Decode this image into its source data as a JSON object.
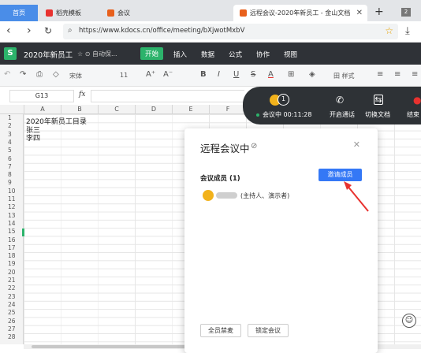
{
  "browser": {
    "tabs": [
      {
        "label": "首页"
      },
      {
        "label": "稻壳模板"
      },
      {
        "label": "会议"
      },
      {
        "label": "远程会议-2020年新员工 - 金山文档"
      }
    ],
    "tab_close": "✕",
    "new_tab": "+",
    "url": "https://www.kdocs.cn/office/meeting/bXjwotMxbV"
  },
  "app": {
    "title": "2020年新员工",
    "status": "☆ ⊙ 自动保...",
    "menus": [
      "开始",
      "插入",
      "数据",
      "公式",
      "协作",
      "视图"
    ]
  },
  "toolbar": {
    "font": "宋体",
    "size": "11",
    "style_label": "田 样式"
  },
  "formula": {
    "cell_ref": "G13",
    "fx": "fx"
  },
  "grid": {
    "columns": [
      "A",
      "B",
      "C",
      "D",
      "E",
      "F"
    ],
    "rows": [
      "1",
      "2",
      "3",
      "4",
      "5",
      "6",
      "7",
      "8",
      "9",
      "10",
      "11",
      "12",
      "13",
      "14",
      "15",
      "16",
      "17",
      "18",
      "19",
      "20",
      "21",
      "22",
      "23",
      "24",
      "25",
      "26",
      "27",
      "28"
    ],
    "cells": {
      "a1": "2020年新员工目录",
      "a2": "张三",
      "a3": "李四"
    }
  },
  "meeting_bar": {
    "member_count": "1",
    "status": "会议中 00:11:28",
    "actions": [
      "开启通话",
      "切换文档",
      "结束"
    ]
  },
  "meeting_panel": {
    "title": "远程会议中",
    "members_label": "会议成员 (1)",
    "invite_button": "邀请成员",
    "member_role": "(主持人、演示者)",
    "mute_all": "全员禁麦",
    "lock": "锁定会议"
  },
  "colors": {
    "accent_green": "#2cb36b",
    "invite_blue": "#3478f6",
    "arrow_red": "#e8322f",
    "dark_bar": "#2e3236"
  }
}
